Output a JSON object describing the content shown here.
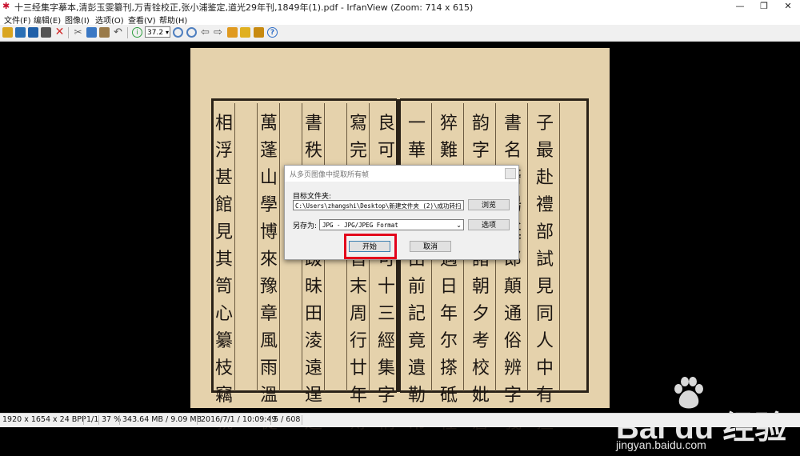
{
  "window": {
    "title": "十三经集字摹本,清彭玉雯纂刊,万青铨校正,张小浦鉴定,道光29年刊,1849年(1).pdf - IrfanView (Zoom: 714 x 615)",
    "minimize": "—",
    "restore": "❐",
    "close": "✕"
  },
  "menu": [
    {
      "label": "文件(F)"
    },
    {
      "label": "编辑(E)"
    },
    {
      "label": "图像(I)"
    },
    {
      "label": "选项(O)"
    },
    {
      "label": "查看(V)"
    },
    {
      "label": "帮助(H)"
    }
  ],
  "toolbar": {
    "zoom_value": "37.2",
    "icons": [
      {
        "name": "open-folder-icon",
        "color": "#d9a520"
      },
      {
        "name": "thumbnails-icon",
        "color": "#2a6fb5"
      },
      {
        "name": "save-icon",
        "color": "#1f5fa8"
      },
      {
        "name": "print-icon",
        "color": "#555555"
      },
      {
        "name": "delete-icon",
        "color": "#d22a2a"
      },
      {
        "name": "cut-icon",
        "color": "#666666"
      },
      {
        "name": "copy-icon",
        "color": "#3a78c4"
      },
      {
        "name": "paste-icon",
        "color": "#9a7b4a"
      },
      {
        "name": "undo-icon",
        "color": "#555555"
      },
      {
        "name": "info-icon",
        "color": "#2e9e3e"
      },
      {
        "name": "zoom-in-icon",
        "color": "#4f7fbf"
      },
      {
        "name": "zoom-out-icon",
        "color": "#4f7fbf"
      },
      {
        "name": "previous-icon",
        "color": "#5a5a5a"
      },
      {
        "name": "next-icon",
        "color": "#5a5a5a"
      },
      {
        "name": "slideshow-icon",
        "color": "#e09a20"
      },
      {
        "name": "effects-icon",
        "color": "#e0b020"
      },
      {
        "name": "settings-icon",
        "color": "#c88a10"
      },
      {
        "name": "help-icon",
        "color": "#2f6fc8"
      }
    ]
  },
  "dialog": {
    "title": "从多页图像中提取所有帧",
    "target_folder_label": "目标文件夹:",
    "target_folder_value": "C:\\Users\\zhangshi\\Desktop\\新建文件夹 (2)\\成功转扫",
    "browse_button": "浏览",
    "save_as_label": "另存为:",
    "format_value": "JPG - JPG/JPEG Format",
    "options_button": "选项",
    "start_button": "开始",
    "cancel_button": "取消"
  },
  "watermark": {
    "brand": "Bai du 经验",
    "url": "jingyan.baidu.com"
  },
  "status": {
    "dimensions": "1920 x 1654 x 24 BPP",
    "page_fraction": "1/1",
    "zoom": "37 %",
    "memory": "343.64 MB / 9.09 MB",
    "datetime": "2016/7/1 / 10:09:49",
    "page_index": "5 / 608"
  },
  "colors": {
    "highlight_box": "#e3001b",
    "paper": "#e5d2ac",
    "ink": "#1c1612"
  }
}
